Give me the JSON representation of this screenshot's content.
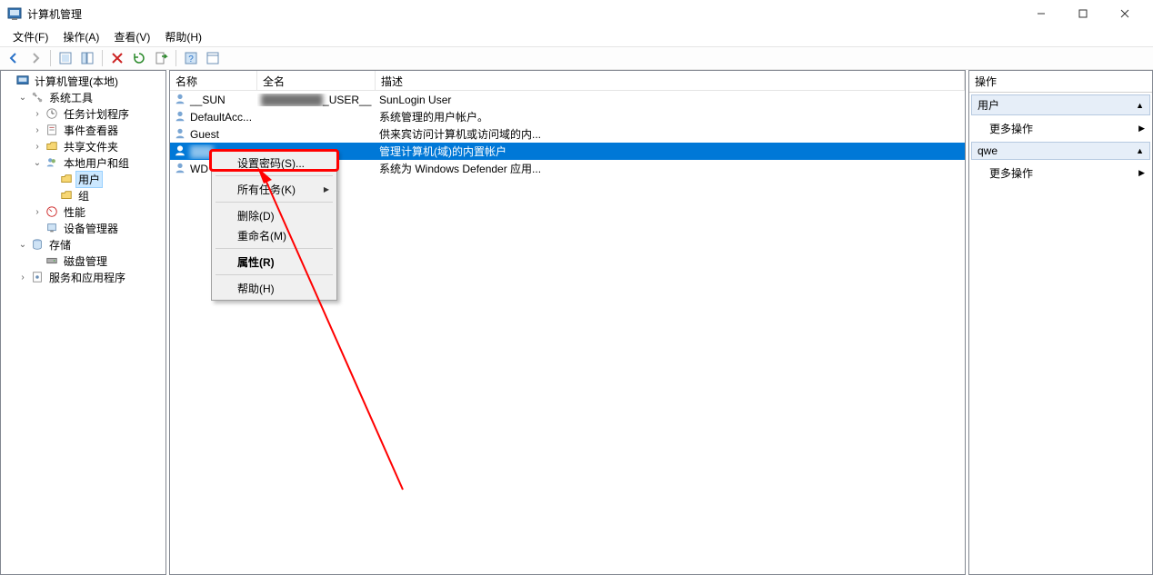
{
  "window": {
    "title": "计算机管理",
    "min_tooltip": "minimize",
    "max_tooltip": "maximize",
    "close_tooltip": "close"
  },
  "menubar": {
    "file": "文件(F)",
    "action": "操作(A)",
    "view": "查看(V)",
    "help": "帮助(H)"
  },
  "tree": {
    "root": "计算机管理(本地)",
    "systools": "系统工具",
    "task": "任务计划程序",
    "event": "事件查看器",
    "shared": "共享文件夹",
    "localusers": "本地用户和组",
    "users": "用户",
    "groups": "组",
    "perf": "性能",
    "devmgr": "设备管理器",
    "storage": "存储",
    "diskmgr": "磁盘管理",
    "services": "服务和应用程序"
  },
  "list": {
    "col_name": "名称",
    "col_full": "全名",
    "col_desc": "描述",
    "rows": [
      {
        "name": "__SUN",
        "full": "_USER__",
        "desc": "SunLogin User"
      },
      {
        "name": "DefaultAcc...",
        "full": "",
        "desc": "系统管理的用户帐户。"
      },
      {
        "name": "Guest",
        "full": "",
        "desc": "供来宾访问计算机或访问域的内..."
      },
      {
        "name": "",
        "full": "",
        "desc": "管理计算机(域)的内置帐户"
      },
      {
        "name": "WD",
        "full": "",
        "desc": "系统为 Windows Defender 应用..."
      }
    ]
  },
  "context_menu": {
    "set_password": "设置密码(S)...",
    "all_tasks": "所有任务(K)",
    "delete": "删除(D)",
    "rename": "重命名(M)",
    "properties": "属性(R)",
    "help": "帮助(H)"
  },
  "actions": {
    "header": "操作",
    "group1": "用户",
    "more1": "更多操作",
    "group2": "qwe",
    "more2": "更多操作"
  }
}
